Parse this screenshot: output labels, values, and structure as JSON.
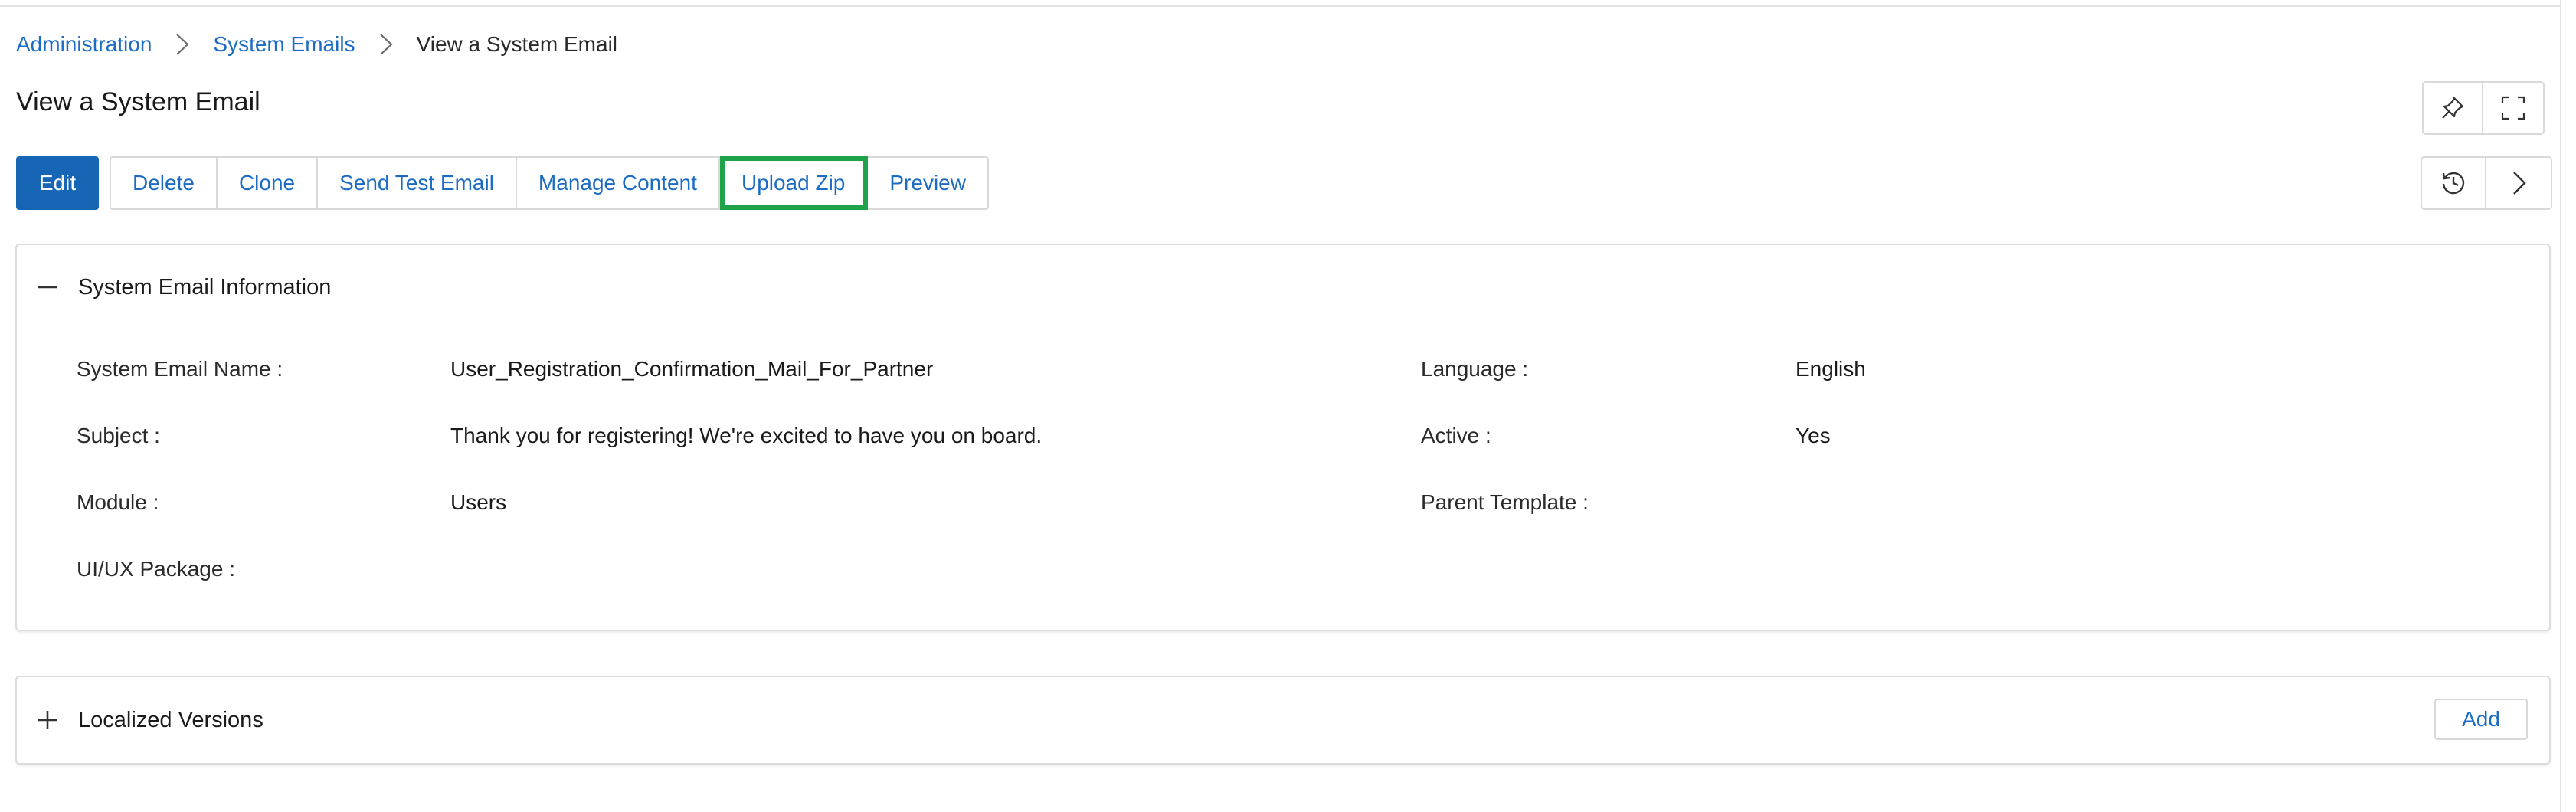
{
  "breadcrumb": {
    "items": [
      "Administration",
      "System Emails"
    ],
    "current": "View a System Email"
  },
  "page": {
    "title": "View a System Email"
  },
  "toolbar": {
    "edit_label": "Edit",
    "actions": [
      "Delete",
      "Clone",
      "Send Test Email",
      "Manage Content",
      "Upload Zip",
      "Preview"
    ],
    "highlighted_action": "Upload Zip"
  },
  "header_icons": {
    "pin": "pin-icon",
    "expand": "fullscreen-icon",
    "history": "history-icon",
    "next": "chevron-right-icon"
  },
  "info_panel": {
    "title": "System Email Information",
    "toggle_icon": "minus-icon",
    "fields": {
      "name_label": "System Email Name :",
      "name_value": "User_Registration_Confirmation_Mail_For_Partner",
      "language_label": "Language :",
      "language_value": "English",
      "subject_label": "Subject :",
      "subject_value": "Thank you for registering! We're excited to have you on board.",
      "active_label": "Active :",
      "active_value": "Yes",
      "module_label": "Module :",
      "module_value": "Users",
      "parent_label": "Parent Template :",
      "parent_value": "",
      "uiux_label": "UI/UX Package :",
      "uiux_value": ""
    }
  },
  "localized_panel": {
    "title": "Localized Versions",
    "toggle_icon": "plus-icon",
    "add_label": "Add"
  },
  "colors": {
    "primary": "#1666b5",
    "link": "#1d6cc4",
    "highlight": "#1fa34a",
    "border": "#d9d9d9"
  }
}
